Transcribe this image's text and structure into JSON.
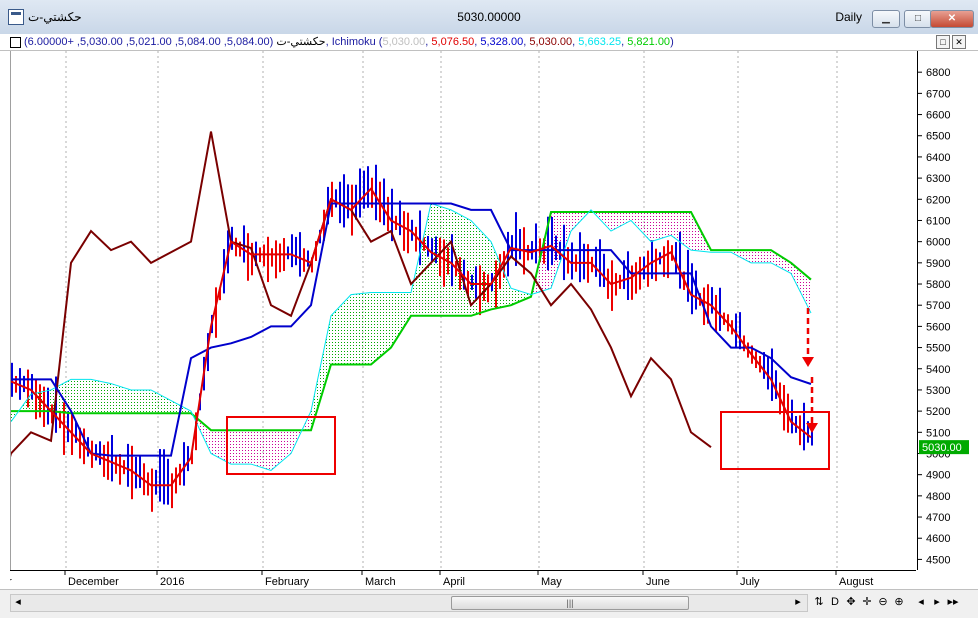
{
  "window": {
    "symbol_title": "حكشتي-ت",
    "center_value": "5030.00000",
    "period": "Daily",
    "buttons": {
      "minimize": "▁",
      "maximize": "□",
      "close": "✕"
    }
  },
  "info": {
    "symbol": "حكشتي-ت",
    "ohlc": " (5,084.00, 5,084.00, 5,021.00, 5,030.00, +6.00000), Ichimoku (",
    "ichimoku_values": [
      {
        "text": "5,030.00",
        "color": "#c0c0c0"
      },
      {
        "text": "5,076.50",
        "color": "#e00000"
      },
      {
        "text": "5,328.00",
        "color": "#0000cc"
      },
      {
        "text": "5,030.00",
        "color": "#8b0000"
      },
      {
        "text": "5,663.25",
        "color": "#00e5ee"
      },
      {
        "text": "5,821.00",
        "color": "#00cc00"
      }
    ],
    "closing": ")",
    "restore_icon": "□",
    "close_icon": "✕"
  },
  "chart_data": {
    "type": "candlestick-ichimoku",
    "ylim": [
      4450,
      6900
    ],
    "y_ticks": [
      4500,
      4600,
      4700,
      4800,
      4900,
      5000,
      5100,
      5200,
      5300,
      5400,
      5500,
      5600,
      5700,
      5800,
      5900,
      6000,
      6100,
      6200,
      6300,
      6400,
      6500,
      6600,
      6700,
      6800
    ],
    "x_labels": [
      "er",
      "December",
      "2016",
      "February",
      "March",
      "April",
      "May",
      "June",
      "July",
      "August"
    ],
    "last_price": "5030.00",
    "colors": {
      "up_bar": "#0000dd",
      "down_bar": "#ee0000",
      "tenkan": "#e00000",
      "kijun": "#0000cc",
      "chikou": "#7a0000",
      "span_a": "#00e5ee",
      "span_b": "#00cc00",
      "cloud_bull": "#00aa00",
      "cloud_bear": "#cc0099",
      "highlight_box": "#ee0000",
      "price_tag": "#00aa00"
    },
    "series": [
      {
        "name": "Tenkan",
        "x": [
          0,
          5,
          10,
          15,
          20,
          25,
          30,
          35,
          40,
          45,
          50,
          55,
          60,
          65,
          70,
          75,
          80,
          85,
          90,
          95,
          100,
          105,
          110,
          115,
          120,
          125,
          130,
          135,
          140,
          145,
          150,
          155,
          160,
          165,
          170,
          175,
          180,
          185,
          190,
          195,
          200
        ],
        "y": [
          5340,
          5300,
          5200,
          5100,
          5000,
          4960,
          4920,
          4850,
          4850,
          4980,
          5600,
          6000,
          5940,
          5940,
          5940,
          5900,
          6200,
          6150,
          6250,
          6100,
          6050,
          5950,
          5900,
          5800,
          5800,
          5970,
          5950,
          5980,
          5900,
          5900,
          5800,
          5830,
          5900,
          5950,
          5750,
          5700,
          5600,
          5470,
          5350,
          5150,
          5076
        ]
      },
      {
        "name": "Kijun",
        "x": [
          0,
          5,
          10,
          15,
          20,
          25,
          30,
          35,
          40,
          45,
          50,
          55,
          60,
          65,
          70,
          75,
          80,
          85,
          90,
          95,
          100,
          105,
          110,
          115,
          120,
          125,
          130,
          135,
          140,
          145,
          150,
          155,
          160,
          165,
          170,
          175,
          180,
          185,
          190,
          195,
          200
        ],
        "y": [
          5350,
          5350,
          5350,
          5200,
          5000,
          4990,
          4990,
          4990,
          4990,
          5450,
          5500,
          5520,
          5550,
          5600,
          5600,
          5700,
          6180,
          6180,
          6180,
          6180,
          6180,
          6180,
          6180,
          6150,
          6150,
          5960,
          5960,
          5960,
          5960,
          5960,
          5960,
          5850,
          5850,
          5850,
          5850,
          5600,
          5500,
          5500,
          5450,
          5360,
          5328
        ]
      },
      {
        "name": "Chikou",
        "x": [
          -3,
          0,
          5,
          10,
          15,
          20,
          25,
          30,
          35,
          40,
          45,
          50,
          55,
          60,
          65,
          70,
          75,
          80,
          85,
          90,
          95,
          100,
          105,
          110,
          115,
          120,
          125,
          130,
          135,
          140,
          145,
          150,
          155,
          160,
          165,
          170,
          175
        ],
        "y": [
          4800,
          5000,
          5100,
          5060,
          5900,
          6050,
          5960,
          6000,
          5900,
          5950,
          6000,
          6520,
          6000,
          5970,
          5700,
          5650,
          5900,
          6200,
          6150,
          6000,
          6050,
          5800,
          5900,
          6000,
          5700,
          5800,
          5930,
          5850,
          5700,
          5800,
          5680,
          5500,
          5270,
          5450,
          5350,
          5100,
          5030
        ]
      },
      {
        "name": "Senkou A",
        "x": [
          0,
          5,
          10,
          15,
          20,
          25,
          30,
          35,
          40,
          45,
          50,
          55,
          60,
          65,
          70,
          75,
          80,
          85,
          90,
          95,
          100,
          105,
          110,
          115,
          120,
          125,
          130,
          135,
          140,
          145,
          150,
          155,
          160,
          165,
          170,
          175,
          180,
          185,
          190,
          195,
          200
        ],
        "y": [
          5150,
          5280,
          5300,
          5350,
          5350,
          5330,
          5300,
          5300,
          5250,
          5200,
          5000,
          4950,
          4950,
          4920,
          5000,
          5200,
          5650,
          5750,
          5760,
          5760,
          5760,
          6180,
          6150,
          6100,
          6000,
          5780,
          5750,
          5780,
          6050,
          6150,
          6050,
          6100,
          6000,
          6030,
          5960,
          5950,
          5950,
          5900,
          5900,
          5850,
          5663
        ]
      },
      {
        "name": "Senkou B",
        "x": [
          0,
          5,
          10,
          15,
          20,
          25,
          30,
          35,
          40,
          45,
          50,
          55,
          60,
          65,
          70,
          75,
          80,
          85,
          90,
          95,
          100,
          105,
          110,
          115,
          120,
          125,
          130,
          135,
          140,
          145,
          150,
          155,
          160,
          165,
          170,
          175,
          180,
          185,
          190,
          195,
          200
        ],
        "y": [
          5200,
          5200,
          5200,
          5190,
          5190,
          5190,
          5190,
          5190,
          5190,
          5190,
          5110,
          5110,
          5110,
          5110,
          5110,
          5110,
          5420,
          5420,
          5420,
          5500,
          5650,
          5650,
          5650,
          5650,
          5680,
          5700,
          5740,
          6140,
          6140,
          6140,
          6140,
          6140,
          6140,
          6140,
          6140,
          5960,
          5960,
          5960,
          5960,
          5900,
          5821
        ]
      }
    ]
  }
}
